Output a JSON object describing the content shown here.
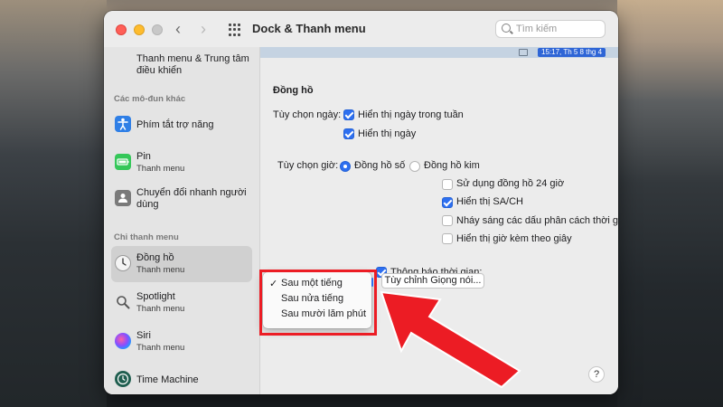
{
  "window": {
    "title": "Dock & Thanh menu",
    "search_placeholder": "Tìm kiếm"
  },
  "sidebar": {
    "top_item": {
      "label": "Thanh menu & Trung tâm điều khiển"
    },
    "section_other": "Các mô-đun khác",
    "other_items": [
      {
        "label": "Phím tắt trợ năng",
        "sub": "",
        "icon": "accessibility-icon",
        "color": "#2f7fe6"
      },
      {
        "label": "Pin",
        "sub": "Thanh menu",
        "icon": "battery-icon",
        "color": "#35c759"
      },
      {
        "label": "Chuyển đổi nhanh người dùng",
        "sub": "",
        "icon": "user-switch-icon",
        "color": "#7a7a7a"
      }
    ],
    "section_menu_only": "Chỉ thanh menu",
    "menu_items": [
      {
        "label": "Đồng hồ",
        "sub": "Thanh menu",
        "icon": "clock-icon",
        "selected": true
      },
      {
        "label": "Spotlight",
        "sub": "Thanh menu",
        "icon": "spotlight-icon"
      },
      {
        "label": "Siri",
        "sub": "Thanh menu",
        "icon": "siri-icon"
      },
      {
        "label": "Time Machine",
        "sub": "",
        "icon": "time-machine-icon"
      }
    ]
  },
  "menubar_preview": {
    "clock_text": "15:17, Th 5 8 thg 4"
  },
  "clock": {
    "section_title": "Đồng hồ",
    "date_options_label": "Tùy chọn ngày:",
    "show_weekday": {
      "label": "Hiển thị ngày trong tuần",
      "checked": true
    },
    "show_date": {
      "label": "Hiển thị ngày",
      "checked": true
    },
    "time_options_label": "Tùy chọn giờ:",
    "radio_digital": {
      "label": "Đồng hồ số",
      "selected": true
    },
    "radio_analog": {
      "label": "Đồng hồ kim",
      "selected": false
    },
    "use_24h": {
      "label": "Sử dụng đồng hồ 24 giờ",
      "checked": false
    },
    "show_ampm": {
      "label": "Hiển thị SA/CH",
      "checked": true
    },
    "flash_separators": {
      "label": "Nháy sáng các dấu phân cách thời gian",
      "checked": false
    },
    "show_seconds": {
      "label": "Hiển thị giờ kèm theo giây",
      "checked": false
    },
    "announce": {
      "label": "Thông báo thời gian:",
      "checked": true
    },
    "interval_options": [
      "Sau một tiếng",
      "Sau nửa tiếng",
      "Sau mười lăm phút"
    ],
    "interval_selected": "Sau một tiếng",
    "check_mark": "✓",
    "customize_voice_button": "Tùy chỉnh Giọng nói...",
    "help": "?"
  },
  "annotation": {
    "color": "#ec1c24"
  }
}
